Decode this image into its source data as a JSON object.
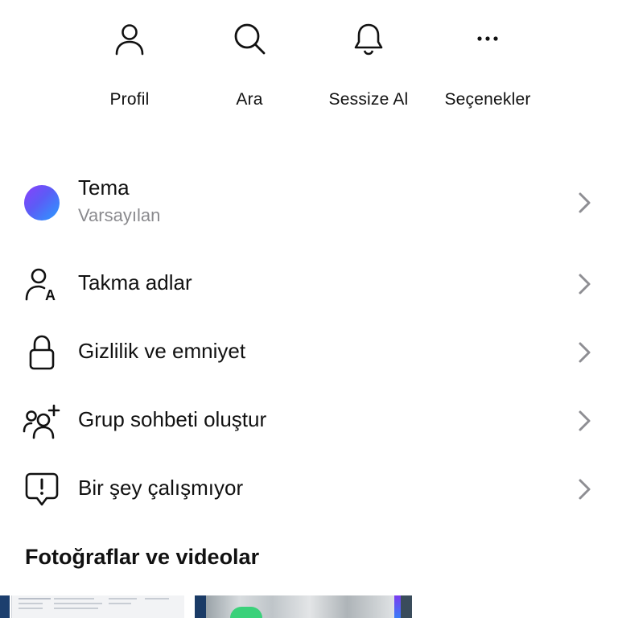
{
  "actions": [
    {
      "label": "Profil",
      "icon": "person-icon"
    },
    {
      "label": "Ara",
      "icon": "search-icon"
    },
    {
      "label": "Sessize Al",
      "icon": "bell-icon"
    },
    {
      "label": "Seçenekler",
      "icon": "more-icon"
    }
  ],
  "menu": {
    "theme": {
      "title": "Tema",
      "subtitle": "Varsayılan",
      "icon": "theme-gradient-dot"
    },
    "items": [
      {
        "title": "Takma adlar",
        "icon": "nickname-icon"
      },
      {
        "title": "Gizlilik ve emniyet",
        "icon": "lock-icon"
      },
      {
        "title": "Grup sohbeti oluştur",
        "icon": "group-add-icon"
      },
      {
        "title": "Bir şey çalışmıyor",
        "icon": "report-problem-icon"
      }
    ]
  },
  "media": {
    "section_title": "Fotoğraflar ve videolar"
  },
  "colors": {
    "text": "#111111",
    "secondary": "#8a8a8e",
    "chevron": "#8e8e93",
    "theme_gradient_start": "#8a3ffc",
    "theme_gradient_end": "#2a9cff"
  }
}
